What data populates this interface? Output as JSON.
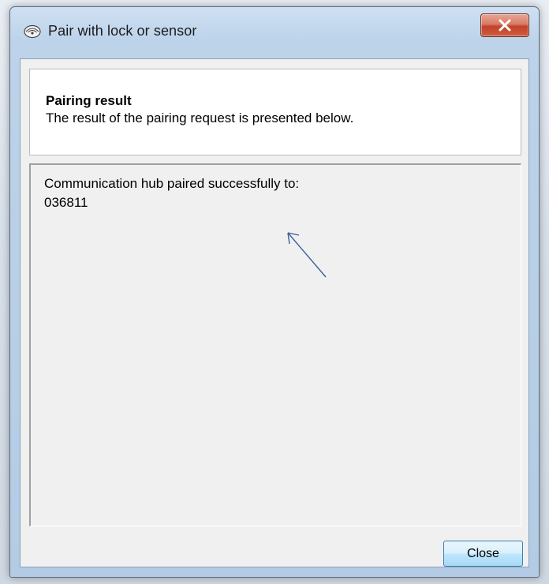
{
  "window": {
    "title": "Pair with lock or sensor",
    "title_icon": "hand-wave-icon",
    "close_icon": "close-icon"
  },
  "header": {
    "title": "Pairing result",
    "description": "The result of the pairing request is presented below."
  },
  "result": {
    "message": "Communication hub paired successfully to:",
    "device_id": "036811"
  },
  "annotation": {
    "icon": "arrow-icon",
    "color": "#3a5f9a"
  },
  "footer": {
    "close_label": "Close"
  }
}
